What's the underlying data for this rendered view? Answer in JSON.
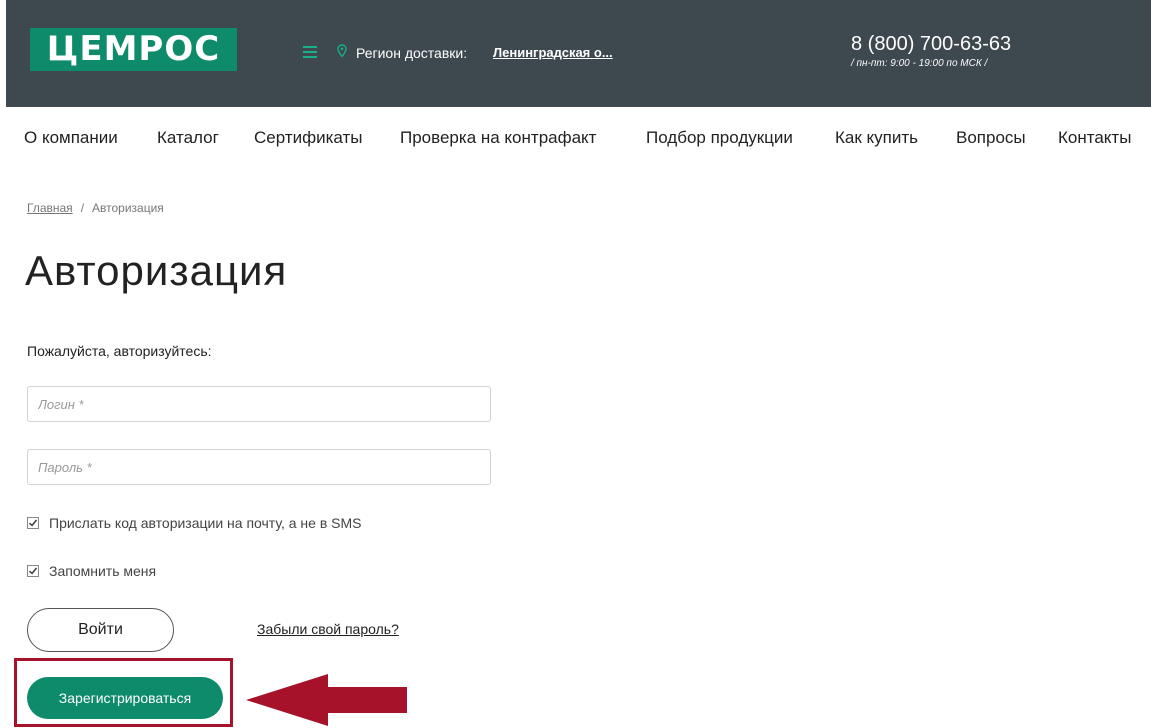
{
  "header": {
    "logo_text": "ЦЕМРОС",
    "region_label": "Регион доставки:",
    "region_value": "Ленинградская о...",
    "phone": "8 (800) 700-63-63",
    "hours": "/ пн-пт: 9:00 - 19:00 по МСК /",
    "bg_color": "#3d484f",
    "brand_color": "#0e8b6a"
  },
  "nav": {
    "items": [
      {
        "label": "О компании"
      },
      {
        "label": "Каталог"
      },
      {
        "label": "Сертификаты"
      },
      {
        "label": "Проверка на контрафакт"
      },
      {
        "label": "Подбор продукции"
      },
      {
        "label": "Как купить"
      },
      {
        "label": "Вопросы"
      },
      {
        "label": "Контакты"
      }
    ]
  },
  "breadcrumb": {
    "home": "Главная",
    "separator": "/",
    "current": "Авторизация"
  },
  "page": {
    "title": "Авторизация",
    "prompt": "Пожалуйста, авторизуйтесь:"
  },
  "form": {
    "login_placeholder": "Логин *",
    "password_placeholder": "Пароль *",
    "email_code_label": "Прислать код авторизации на почту, а не в SMS",
    "email_code_checked": true,
    "remember_label": "Запомнить меня",
    "remember_checked": true,
    "login_button": "Войти",
    "forgot_link": "Забыли свой пароль?",
    "register_button": "Зарегистрироваться"
  },
  "annotation": {
    "highlight_color": "#a5122a",
    "arrow_icon": "left-arrow-icon"
  }
}
